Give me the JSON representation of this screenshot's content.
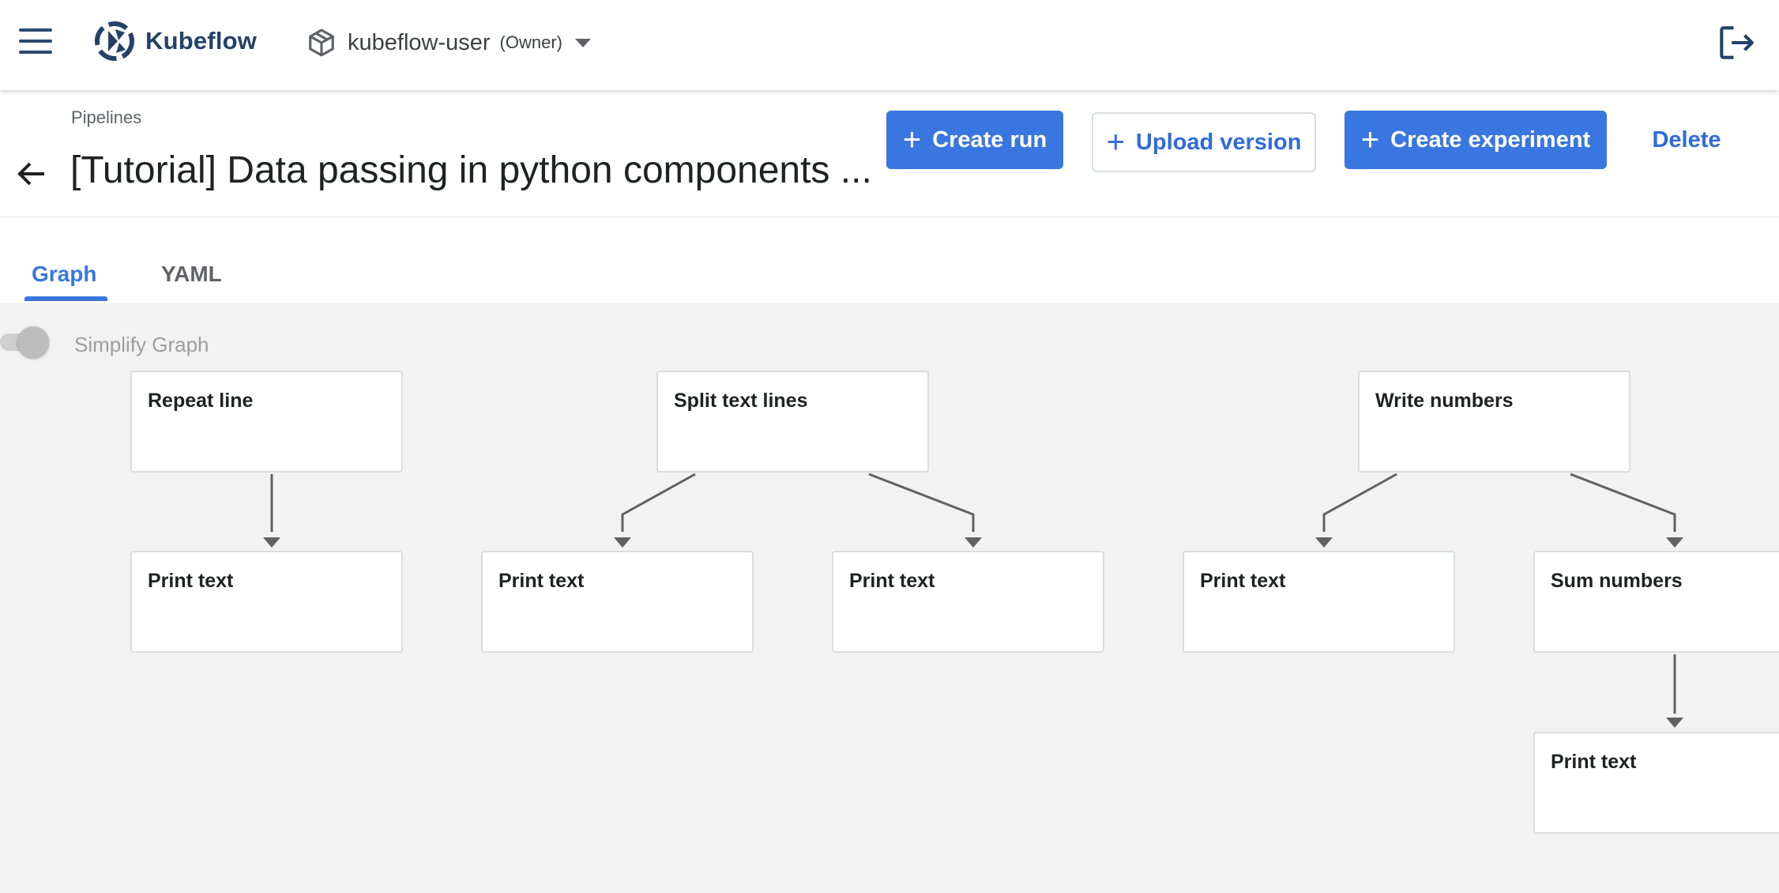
{
  "topbar": {
    "brand": "Kubeflow",
    "namespace": "kubeflow-user",
    "role": "(Owner)",
    "icons": [
      "menu-icon",
      "kubeflow-logo",
      "cube-icon",
      "dropdown-arrow-icon",
      "logout-icon"
    ]
  },
  "header": {
    "breadcrumb": "Pipelines",
    "title": "[Tutorial] Data passing in python components ...",
    "buttons": {
      "create_run": "Create run",
      "upload_version": "Upload version",
      "create_experiment": "Create experiment",
      "delete": "Delete"
    }
  },
  "tabs": [
    {
      "label": "Graph",
      "selected": true
    },
    {
      "label": "YAML",
      "selected": false
    }
  ],
  "graph": {
    "simplify_label": "Simplify Graph",
    "simplify_on": false,
    "nodes": [
      {
        "id": "repeat-line",
        "label": "Repeat line"
      },
      {
        "id": "split-text-lines",
        "label": "Split text lines"
      },
      {
        "id": "write-numbers",
        "label": "Write numbers"
      },
      {
        "id": "print-text-1",
        "label": "Print text"
      },
      {
        "id": "print-text-2",
        "label": "Print text"
      },
      {
        "id": "print-text-3",
        "label": "Print text"
      },
      {
        "id": "print-text-4",
        "label": "Print text"
      },
      {
        "id": "sum-numbers",
        "label": "Sum numbers"
      },
      {
        "id": "print-text-5",
        "label": "Print text"
      }
    ],
    "edges": [
      [
        "repeat-line",
        "print-text-1"
      ],
      [
        "split-text-lines",
        "print-text-2"
      ],
      [
        "split-text-lines",
        "print-text-3"
      ],
      [
        "write-numbers",
        "print-text-4"
      ],
      [
        "write-numbers",
        "sum-numbers"
      ],
      [
        "sum-numbers",
        "print-text-5"
      ]
    ]
  },
  "colors": {
    "primary": "#3a76e0",
    "brand_text": "#23416a",
    "graph_bg": "#f2f2f2",
    "edge": "#616161"
  }
}
